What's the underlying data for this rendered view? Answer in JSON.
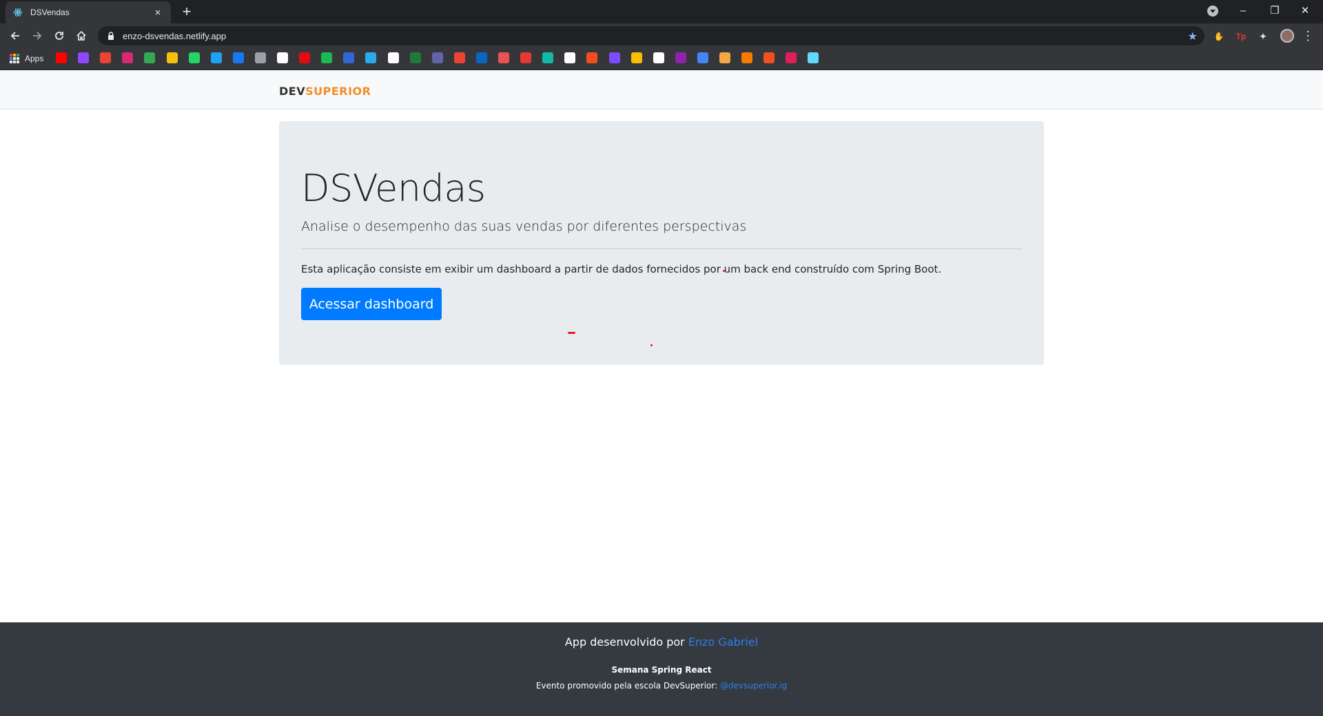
{
  "browser": {
    "tab_title": "DSVendas",
    "tab_close": "×",
    "new_tab": "+",
    "url": "enzo-dsvendas.netlify.app",
    "bookmarks_apps_label": "Apps",
    "window_controls": {
      "minimize": "–",
      "restore": "❐",
      "close": "✕"
    },
    "extensions": [
      {
        "name": "adblock-icon",
        "glyph": "✋",
        "color": "#e53935"
      },
      {
        "name": "tp-extension-icon",
        "glyph": "Tp",
        "color": "#e53935"
      },
      {
        "name": "extensions-puzzle-icon",
        "glyph": "✦",
        "color": "#e8eaed"
      }
    ],
    "bookmark_icons": [
      {
        "name": "youtube-icon",
        "color": "#ff0000"
      },
      {
        "name": "twitch-icon",
        "color": "#9146ff"
      },
      {
        "name": "gmail-icon",
        "color": "#ea4335"
      },
      {
        "name": "instagram-icon",
        "color": "#d62976"
      },
      {
        "name": "go-icon",
        "color": "#34a853"
      },
      {
        "name": "pb-icon",
        "color": "#f4c20d"
      },
      {
        "name": "whatsapp-icon",
        "color": "#25d366"
      },
      {
        "name": "twitter-icon",
        "color": "#1da1f2"
      },
      {
        "name": "facebook-icon",
        "color": "#1877f2"
      },
      {
        "name": "star-bookmark-icon",
        "color": "#9aa0a6"
      },
      {
        "name": "github-icon",
        "color": "#ffffff"
      },
      {
        "name": "netflix-icon",
        "color": "#e50914"
      },
      {
        "name": "spotify-icon",
        "color": "#1db954"
      },
      {
        "name": "blue-bar-icon",
        "color": "#3367d6"
      },
      {
        "name": "telegram-icon",
        "color": "#2aabee"
      },
      {
        "name": "notion-icon",
        "color": "#ffffff"
      },
      {
        "name": "bet365-icon",
        "color": "#1e7a3c"
      },
      {
        "name": "teams-icon",
        "color": "#6264a7"
      },
      {
        "name": "calendar-icon",
        "color": "#ea4335"
      },
      {
        "name": "linkedin-icon",
        "color": "#0a66c2"
      },
      {
        "name": "udemy-icon",
        "color": "#ec5252"
      },
      {
        "name": "red-square-icon",
        "color": "#e53935"
      },
      {
        "name": "cross-icon",
        "color": "#14b8a6"
      },
      {
        "name": "globe-icon",
        "color": "#ffffff"
      },
      {
        "name": "figma-icon",
        "color": "#f24e1e"
      },
      {
        "name": "purple-m-icon",
        "color": "#7c4dff"
      },
      {
        "name": "drive-icon",
        "color": "#fbbc04"
      },
      {
        "name": "globe-2-icon",
        "color": "#ffffff"
      },
      {
        "name": "purple-p-icon",
        "color": "#8e24aa"
      },
      {
        "name": "x-square-icon",
        "color": "#4285f4"
      },
      {
        "name": "in-icon",
        "color": "#f4a742"
      },
      {
        "name": "r-icon",
        "color": "#f57c00"
      },
      {
        "name": "microsoft-icon",
        "color": "#f25022"
      },
      {
        "name": "slack-icon",
        "color": "#e01e5a"
      },
      {
        "name": "react-icon",
        "color": "#61dafb"
      }
    ]
  },
  "site": {
    "logo_dev": "DEV",
    "logo_superior": "SUPERIOR",
    "title": "DSVendas",
    "lead": "Analise o desempenho das suas vendas por diferentes perspectivas",
    "description": "Esta aplicação consiste em exibir um dashboard a partir de dados fornecidos por um back end construído com Spring Boot.",
    "cta_label": "Acessar dashboard",
    "footer": {
      "developed_by": "App desenvolvido por",
      "author": "Enzo Gabriel",
      "event_name": "Semana Spring React",
      "event_text": "Evento promovido pela escola DevSuperior:",
      "instagram": "@devsuperior.ig"
    }
  }
}
